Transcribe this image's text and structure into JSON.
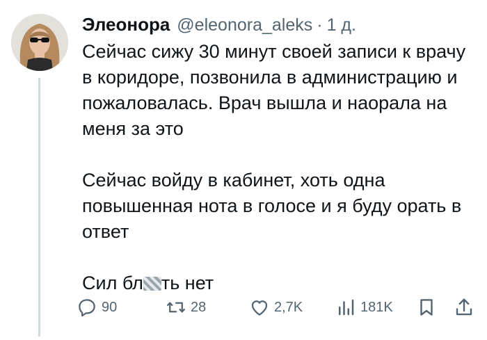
{
  "tweet": {
    "author_name": "Элеонора",
    "author_handle": "@eleonora_aleks",
    "separator": "·",
    "time_ago": "1 д.",
    "paragraphs": [
      "Сейчас сижу 30 минут своей записи к врачу в коридоре, позвонила в администрацию и пожаловалась. Врач вышла и наорала на меня за это",
      "Сейчас войду в кабинет, хоть одна повышенная нота в голосе и я буду орать в ответ"
    ],
    "last_line_before": "Сил бл",
    "last_line_after": "ть нет"
  },
  "actions": {
    "reply_icon": "reply-icon",
    "reply_count": "90",
    "retweet_icon": "retweet-icon",
    "retweet_count": "28",
    "like_icon": "heart-icon",
    "like_count": "2,7K",
    "views_icon": "views-icon",
    "views_count": "181K",
    "bookmark_icon": "bookmark-icon",
    "share_icon": "share-icon"
  },
  "colors": {
    "text": "#0f1419",
    "muted": "#536471",
    "thread_line": "#cfd9de",
    "background": "#ffffff"
  }
}
